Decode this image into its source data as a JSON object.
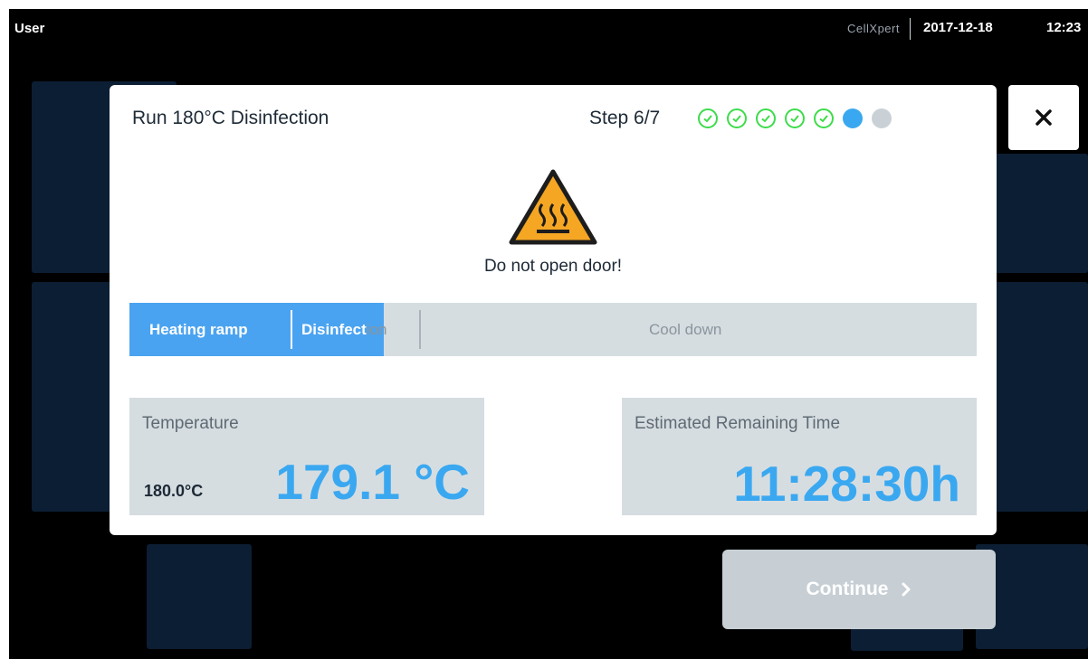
{
  "topbar": {
    "user": "User",
    "brand": "CellXpert",
    "date": "2017-12-18",
    "time": "12:23"
  },
  "dialog": {
    "title": "Run 180°C Disinfection",
    "step_label": "Step 6/7",
    "steps": [
      "done",
      "done",
      "done",
      "done",
      "done",
      "current",
      "todo"
    ],
    "warning_icon": "hot-surface-warning-icon",
    "warning_text": "Do not open door!",
    "progress": {
      "phases": [
        "Heating ramp",
        "Disinfect",
        "ion",
        "Cool down"
      ],
      "fill_fraction": 0.3
    },
    "temperature": {
      "label": "Temperature",
      "setpoint": "180.0°C",
      "value": "179.1 °C"
    },
    "remaining": {
      "label": "Estimated Remaining Time",
      "value": "11:28:30h"
    }
  },
  "close_icon": "close-icon",
  "continue_label": "Continue",
  "colors": {
    "accent": "#3aa8f0",
    "done": "#3ddc4a",
    "panel": "#d6dde1",
    "warning": "#f5a623"
  }
}
